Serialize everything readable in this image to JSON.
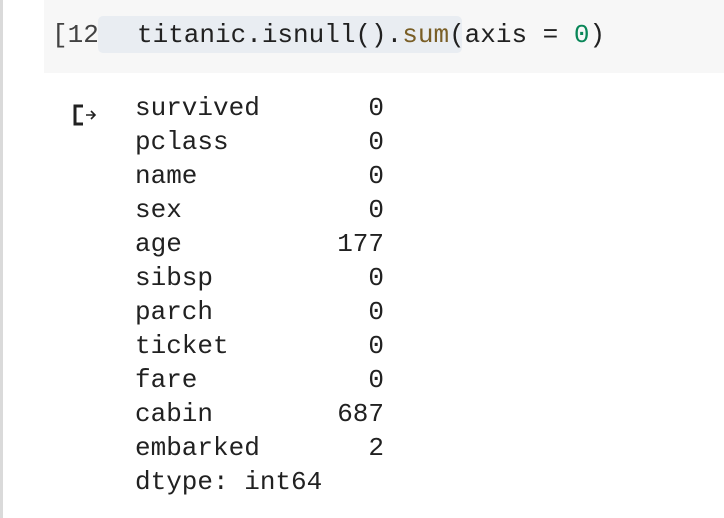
{
  "cell": {
    "execution_count": "[12]",
    "code": {
      "obj": "titanic.isnull().",
      "fn": "sum",
      "args_open": "(axis = ",
      "num": "0",
      "close": ")"
    }
  },
  "output": {
    "rows": [
      {
        "name": "survived",
        "value": "0"
      },
      {
        "name": "pclass",
        "value": "0"
      },
      {
        "name": "name",
        "value": "0"
      },
      {
        "name": "sex",
        "value": "0"
      },
      {
        "name": "age",
        "value": "177"
      },
      {
        "name": "sibsp",
        "value": "0"
      },
      {
        "name": "parch",
        "value": "0"
      },
      {
        "name": "ticket",
        "value": "0"
      },
      {
        "name": "fare",
        "value": "0"
      },
      {
        "name": "cabin",
        "value": "687"
      },
      {
        "name": "embarked",
        "value": "2"
      }
    ],
    "dtype": "dtype: int64"
  },
  "icons": {
    "output": "output-arrow-icon"
  }
}
